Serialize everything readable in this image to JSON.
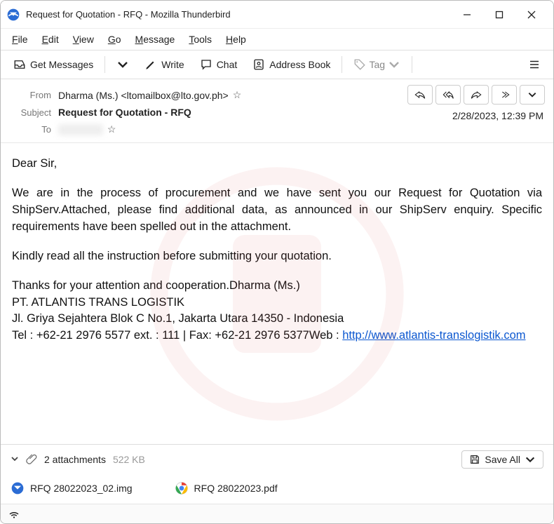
{
  "window": {
    "title": "Request for Quotation - RFQ - Mozilla Thunderbird"
  },
  "menu": {
    "file": "File",
    "edit": "Edit",
    "view": "View",
    "go": "Go",
    "message": "Message",
    "tools": "Tools",
    "help": "Help"
  },
  "toolbar": {
    "get": "Get Messages",
    "write": "Write",
    "chat": "Chat",
    "address": "Address Book",
    "tag": "Tag"
  },
  "headers": {
    "from_label": "From",
    "from_value": "Dharma (Ms.) <ltomailbox@lto.gov.ph>",
    "subject_label": "Subject",
    "subject_value": "Request for Quotation - RFQ",
    "to_label": "To",
    "to_value": "redacted",
    "datetime": "2/28/2023, 12:39 PM"
  },
  "body": {
    "greeting": "Dear Sir,",
    "p1": "We are in the process of procurement and we have sent you our Request for Quotation via ShipServ.Attached, please find additional data, as announced in our ShipServ enquiry. Specific requirements have been spelled out in the attachment.",
    "p2": "Kindly read all the instruction before submitting your quotation.",
    "p3a": "Thanks for your attention and cooperation.Dharma (Ms.)",
    "p3b": "PT. ATLANTIS TRANS LOGISTIK",
    "p3c": "Jl. Griya Sejahtera Blok C No.1, Jakarta Utara 14350 - Indonesia",
    "p3d": "Tel : +62-21 2976 5577 ext. : 111 |  Fax: +62-21 2976 5377Web : ",
    "link": "http://www.atlantis-translogistik.com"
  },
  "attachments": {
    "count_label": "2 attachments",
    "size": "522 KB",
    "save_all": "Save All",
    "items": [
      {
        "name": "RFQ 28022023_02.img"
      },
      {
        "name": "RFQ 28022023.pdf"
      }
    ]
  }
}
